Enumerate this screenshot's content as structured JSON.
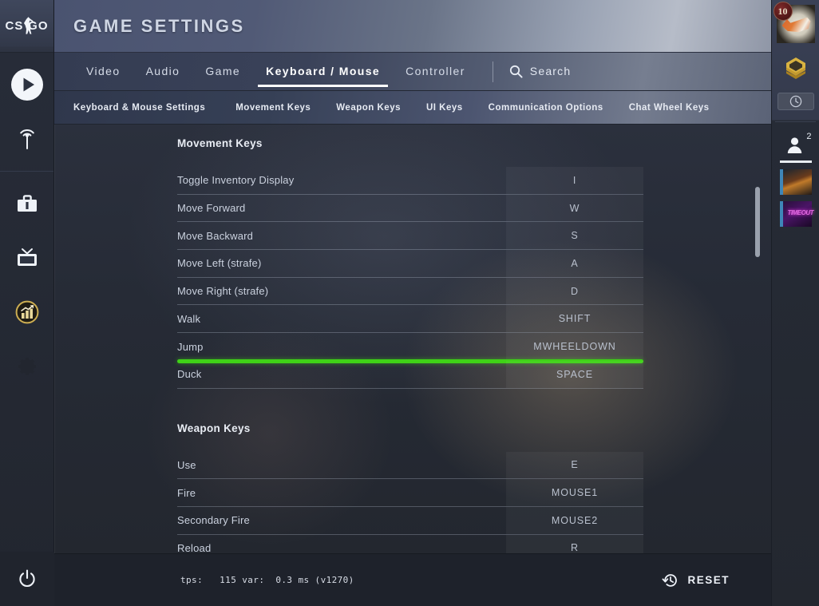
{
  "app": {
    "logo_left": "CS",
    "logo_right": "GO",
    "title": "GAME SETTINGS"
  },
  "left_rail": {
    "items": [
      {
        "name": "play",
        "icon": "play-icon"
      },
      {
        "name": "watch-broadcast",
        "icon": "broadcast-icon"
      },
      {
        "name": "inventory",
        "icon": "briefcase-icon"
      },
      {
        "name": "tv",
        "icon": "tv-icon"
      },
      {
        "name": "stats",
        "icon": "stats-medal-icon"
      },
      {
        "name": "settings",
        "icon": "gear-icon"
      }
    ],
    "power_label": "power-icon"
  },
  "right_rail": {
    "avatar_badge": "10",
    "rank_icon": "gold-rank-icon",
    "clock_icon": "clock-icon",
    "friends_icon": "person-icon",
    "friends_count": "2",
    "thumb1_label": "",
    "thumb2_label": "TIMEOUT"
  },
  "tabs": {
    "items": [
      {
        "label": "Video",
        "active": false
      },
      {
        "label": "Audio",
        "active": false
      },
      {
        "label": "Game",
        "active": false
      },
      {
        "label": "Keyboard / Mouse",
        "active": true
      },
      {
        "label": "Controller",
        "active": false
      }
    ],
    "search_label": "Search",
    "search_icon": "search-icon"
  },
  "subtabs": {
    "items": [
      "Keyboard & Mouse Settings",
      "Movement Keys",
      "Weapon Keys",
      "UI Keys",
      "Communication Options",
      "Chat Wheel Keys"
    ]
  },
  "sections": [
    {
      "title": "Movement Keys",
      "rows": [
        {
          "label": "Toggle Inventory Display",
          "key": "I",
          "highlight": false
        },
        {
          "label": "Move Forward",
          "key": "W",
          "highlight": false
        },
        {
          "label": "Move Backward",
          "key": "S",
          "highlight": false
        },
        {
          "label": "Move Left (strafe)",
          "key": "A",
          "highlight": false
        },
        {
          "label": "Move Right (strafe)",
          "key": "D",
          "highlight": false
        },
        {
          "label": "Walk",
          "key": "SHIFT",
          "highlight": false
        },
        {
          "label": "Jump",
          "key": "MWHEELDOWN",
          "highlight": true
        },
        {
          "label": "Duck",
          "key": "SPACE",
          "highlight": false
        }
      ]
    },
    {
      "title": "Weapon Keys",
      "rows": [
        {
          "label": "Use",
          "key": "E",
          "highlight": false
        },
        {
          "label": "Fire",
          "key": "MOUSE1",
          "highlight": false
        },
        {
          "label": "Secondary Fire",
          "key": "MOUSE2",
          "highlight": false
        },
        {
          "label": "Reload",
          "key": "R",
          "highlight": false
        }
      ]
    }
  ],
  "footer": {
    "stats": "tps:   115 var:  0.3 ms (v1270)",
    "reset_label": "RESET",
    "reset_icon": "history-restore-icon"
  },
  "colors": {
    "highlight_green": "#3fd217",
    "accent_white": "#ffffff",
    "header_blue": "#4a5370",
    "badge_red": "#7e2a2a",
    "rank_gold": "#d4ab3a"
  }
}
